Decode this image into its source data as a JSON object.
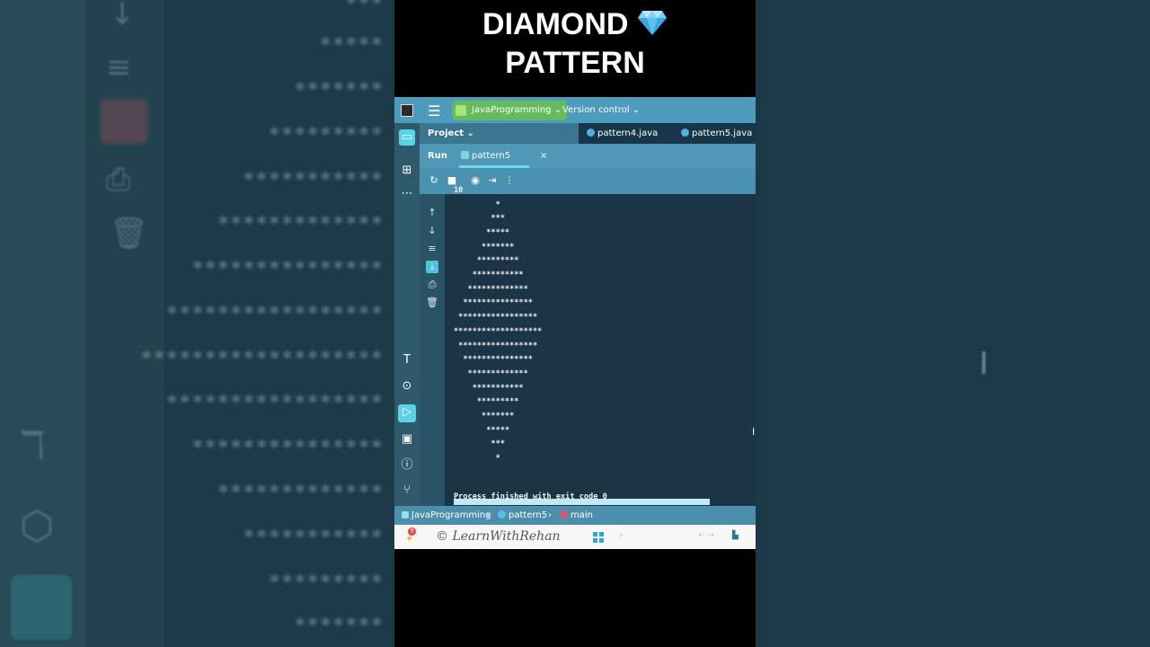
{
  "title": {
    "line1": "DIAMOND",
    "line2": "PATTERN"
  },
  "colors": {
    "ide_bg": "#1c3545",
    "topbar": "#4f9bbd",
    "project_chip": "#66bb5f",
    "accent": "#5bd3e6"
  },
  "topbar": {
    "project": "JavaProgramming",
    "version_control": "Version control"
  },
  "project_panel": {
    "label": "Project"
  },
  "editor_tabs": [
    {
      "label": "pattern4.java"
    },
    {
      "label": "pattern5.java"
    }
  ],
  "run_panel": {
    "label": "Run",
    "tab": "pattern5",
    "close": "×"
  },
  "console": {
    "first_line": "10",
    "lines": [
      "         *",
      "        ***",
      "       *****",
      "      *******",
      "     *********",
      "    ***********",
      "   *************",
      "  ***************",
      " *****************",
      "*******************",
      " *****************",
      "  ***************",
      "   *************",
      "    ***********",
      "     *********",
      "      *******",
      "       *****",
      "        ***",
      "         *"
    ],
    "finished": "Process finished with exit code 0"
  },
  "breadcrumb": {
    "project": "JavaProgramming",
    "file": "pattern5",
    "method": "main",
    "sep": "›"
  },
  "taskbar": {
    "watermark": "© LearnWithRehan",
    "badge": "9"
  },
  "background": {
    "left_stars": [
      "***",
      "*****",
      "*******",
      "*********",
      "***********",
      "*************",
      "***************",
      "*****************",
      "*******************",
      "*****************",
      "***************",
      "*************",
      "***********",
      "*********",
      "*******"
    ]
  }
}
